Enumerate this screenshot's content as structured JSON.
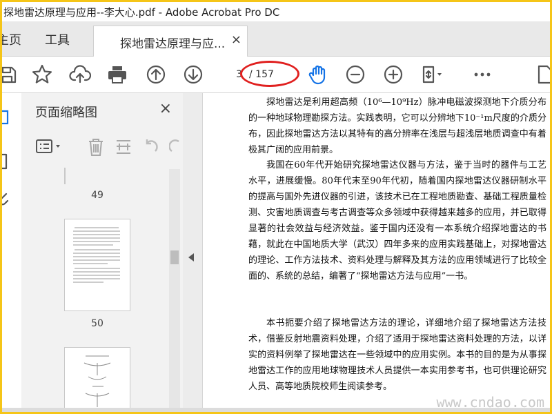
{
  "window": {
    "title": "探地雷达原理与应用--李大心.pdf - Adobe Acrobat Pro DC"
  },
  "tabs": {
    "home": "主页",
    "tools": "工具",
    "document": "探地雷达原理与应...",
    "close_symbol": "×"
  },
  "toolbar": {
    "icons": [
      "save-icon",
      "bookmark-star-icon",
      "upload-cloud-icon",
      "print-icon",
      "page-up-icon",
      "page-down-icon",
      "hand-tool-icon",
      "zoom-out-icon",
      "zoom-in-icon",
      "fit-page-icon",
      "more-icon"
    ],
    "page_current": "3",
    "page_total": "/ 157",
    "highlight_color": "#e0201f",
    "accent_color": "#1473e6"
  },
  "thumbnail_panel": {
    "title": "页面缩略图",
    "close_symbol": "×",
    "pages": [
      {
        "number": "49"
      },
      {
        "number": "50"
      }
    ]
  },
  "document": {
    "paragraphs": [
      "探地雷达是利用超高频（10⁶—10⁹Hz）脉冲电磁波探测地下介质分布的一种地球物理勘探方法。实践表明，它可以分辨地下10⁻¹m尺度的介质分布，因此探地雷达方法以其特有的高分辨率在浅层与超浅层地质调查中有着极其广阔的应用前景。",
      "我国在60年代开始研究探地雷达仪器与方法，鉴于当时的器件与工艺水平，进展缓慢。80年代末至90年代初，随着国内探地雷达仪器研制水平的提高与国外先进仪器的引进，该技术已在工程地质勘查、基础工程质量检测、灾害地质调查与考古调查等众多领域中获得越来越多的应用，并已取得显著的社会效益与经济效益。鉴于国内还没有一本系统介绍探地雷达的书藉，就此在中国地质大学（武汉）四年多来的应用实践基础上，对探地雷达的理论、工作方法技术、资料处理与解释及其方法的应用领域进行了比较全面的、系统的总结，编著了“探地雷达方法与应用”一书。",
      "本书扼要介绍了探地雷达方法的理论，详细地介绍了探地雷达方法技术，借鉴反射地震资料处理，介绍了适用于探地雷达资料处理的方法，以详实的资料例举了探地雷达在一些领域中的应用实例。本书的目的是为从事探地雷达工作的应用地球物理技术人员提供一本实用参考书，也可供理论研究人员、高等地质院校师生阅读参考。"
    ],
    "watermark": "www.cndao.com"
  }
}
